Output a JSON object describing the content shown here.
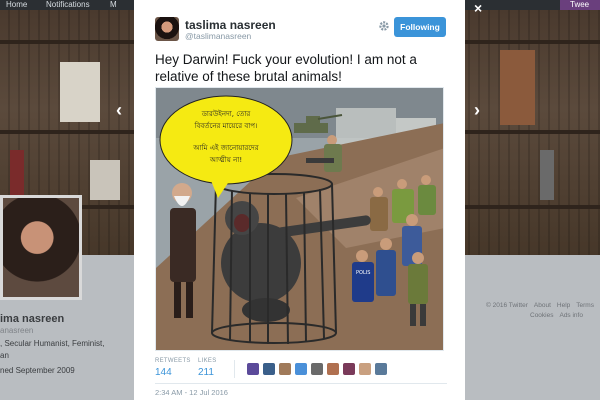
{
  "topbar": {
    "home": "Home",
    "notifications": "Notifications",
    "messages": "M",
    "tweet_button": "Twee"
  },
  "profile": {
    "name": "ima nasreen",
    "handle": "anasreen",
    "bio_line1": ", Secular Humanist, Feminist,",
    "bio_line2": "an",
    "joined": "ned September 2009"
  },
  "footer": {
    "row1": [
      "© 2016 Twitter",
      "About",
      "Help",
      "Terms"
    ],
    "row2": [
      "Cookies",
      "Ads info"
    ]
  },
  "lightbox": {
    "close_label": "×",
    "prev_label": "‹",
    "next_label": "›"
  },
  "tweet": {
    "author_name": "taslima nasreen",
    "author_handle": "@taslimanasreen",
    "follow_label": "Following",
    "text": "Hey Darwin! Fuck your evolution! I am not a relative of these brutal animals!",
    "image": {
      "speech_line1": "ডারউইনদা, তোর",
      "speech_line2": "বিবর্তনের মায়েরে বাপ।",
      "speech_line3": "আমি এই জানোয়ারদের",
      "speech_line4": "আত্মীয় না!",
      "police_label": "POLIS"
    },
    "retweets_label": "RETWEETS",
    "retweets_count": "144",
    "likes_label": "LIKES",
    "likes_count": "211",
    "timestamp": "2:34 AM - 12 Jul 2016"
  },
  "colors": {
    "follow_button": "#3b94d9",
    "stat_value": "#3b94d9",
    "bubble": "#f5ea12"
  },
  "icons": [
    "gear-icon",
    "close-icon",
    "chevron-left-icon",
    "chevron-right-icon"
  ]
}
